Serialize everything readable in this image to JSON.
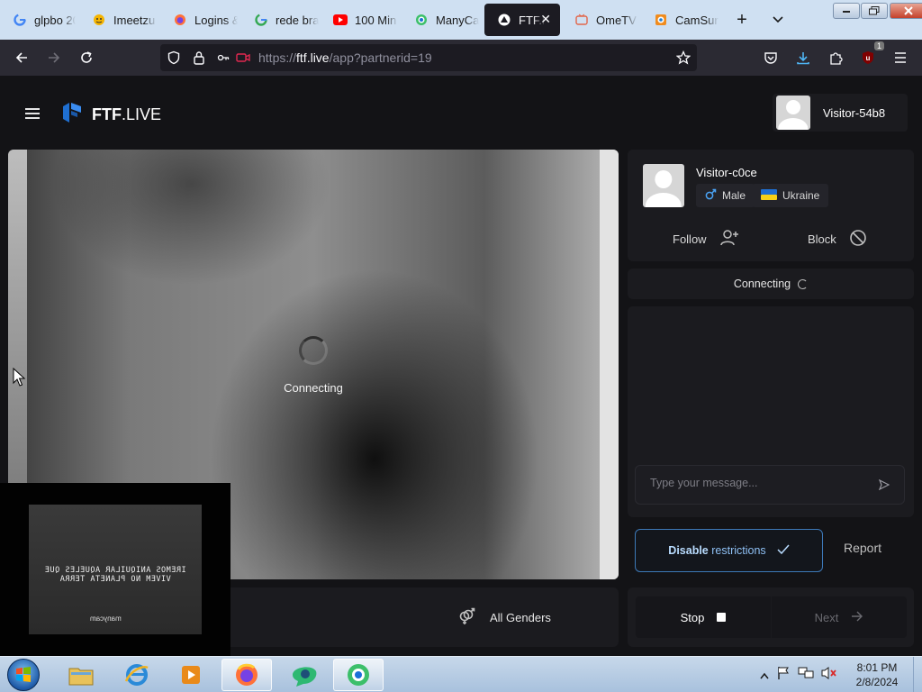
{
  "browser": {
    "tabs": [
      {
        "label": "glpbo 20",
        "icon": "google-icon",
        "active": false
      },
      {
        "label": "Imeetzu",
        "icon": "imeetzu-icon",
        "active": false
      },
      {
        "label": "Logins &",
        "icon": "firefox-icon",
        "active": false
      },
      {
        "label": "rede bra",
        "icon": "google-icon",
        "active": false
      },
      {
        "label": "100 Min",
        "icon": "youtube-icon",
        "active": false
      },
      {
        "label": "ManyCa",
        "icon": "manycam-icon",
        "active": false
      },
      {
        "label": "FTF.li",
        "icon": "ftf-icon",
        "active": true
      },
      {
        "label": "OmeTV",
        "icon": "ometv-icon",
        "active": false
      },
      {
        "label": "CamSurf",
        "icon": "camsurf-icon",
        "active": false
      }
    ],
    "url": {
      "host": "ftf.live",
      "path": "/app?partnerid=19",
      "scheme": "https://"
    },
    "extension_badge": "1"
  },
  "app": {
    "logo": {
      "bold": "FTF",
      "rest": ".LIVE"
    },
    "current_user": {
      "name": "Visitor-54b8"
    },
    "video": {
      "status": "Connecting"
    },
    "self_cam": {
      "overlay_line1": "IREMOS ANIQUILAR AQUELES QUE",
      "overlay_line2": "VIVEM NO PLANETA TERRA",
      "watermark": "manycam"
    },
    "filter": {
      "gender_label": "All Genders"
    },
    "partner": {
      "name": "Visitor-c0ce",
      "gender": "Male",
      "country": "Ukraine"
    },
    "actions": {
      "follow": "Follow",
      "block": "Block"
    },
    "connection": {
      "status": "Connecting"
    },
    "chat": {
      "placeholder": "Type your message..."
    },
    "restrictions": {
      "bold": "Disable",
      "rest": "restrictions"
    },
    "report": "Report",
    "controls": {
      "stop": "Stop",
      "next": "Next"
    }
  },
  "taskbar": {
    "clock_time": "8:01 PM",
    "clock_date": "2/8/2024"
  }
}
